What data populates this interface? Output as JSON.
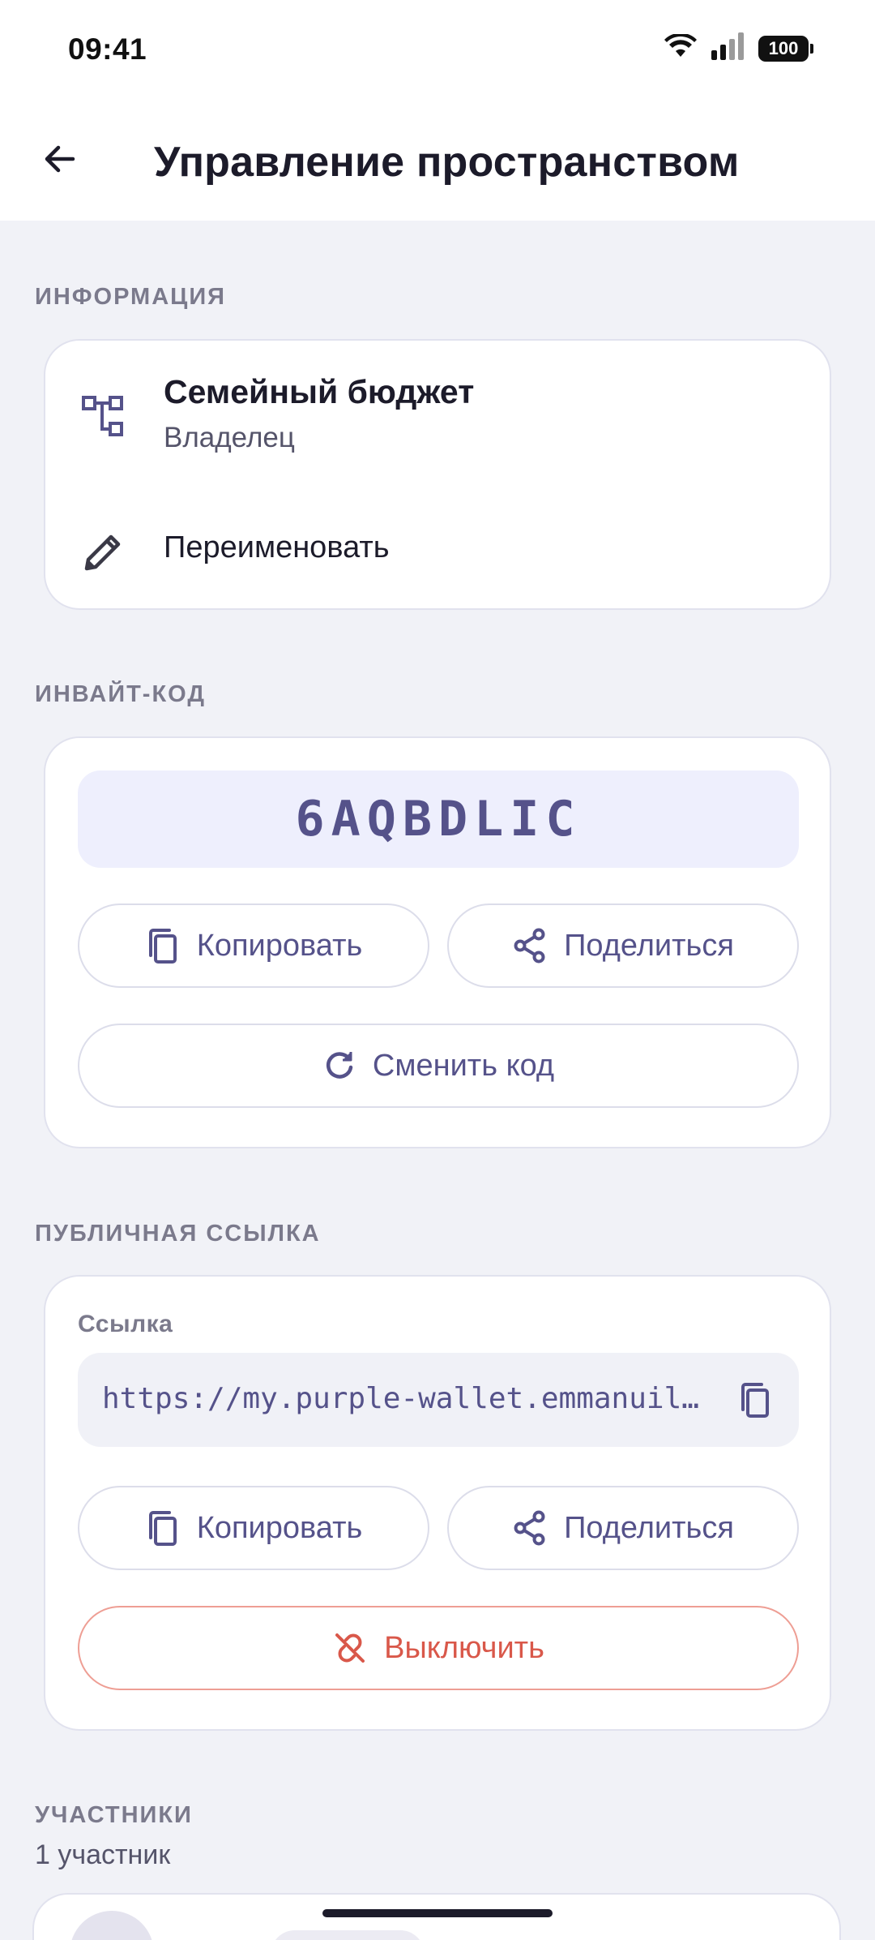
{
  "status_bar": {
    "time": "09:41",
    "battery": "100"
  },
  "header": {
    "title": "Управление пространством"
  },
  "info": {
    "section_label": "ИНФОРМАЦИЯ",
    "space_name": "Семейный бюджет",
    "role": "Владелец",
    "rename_label": "Переименовать"
  },
  "invite": {
    "section_label": "ИНВАЙТ-КОД",
    "code": "6AQBDLIC",
    "copy_label": "Копировать",
    "share_label": "Поделиться",
    "regenerate_label": "Сменить код"
  },
  "public_link": {
    "section_label": "ПУБЛИЧНАЯ ССЫЛКА",
    "field_label": "Ссылка",
    "url": "https://my.purple-wallet.emmanuil…",
    "copy_label": "Копировать",
    "share_label": "Поделиться",
    "disable_label": "Выключить"
  },
  "members": {
    "section_label": "УЧАСТНИКИ",
    "count_text": "1 участник"
  },
  "colors": {
    "accent": "#55528A",
    "danger": "#D9584A",
    "background": "#F1F2F7",
    "code_bg": "#EEEFFD"
  }
}
